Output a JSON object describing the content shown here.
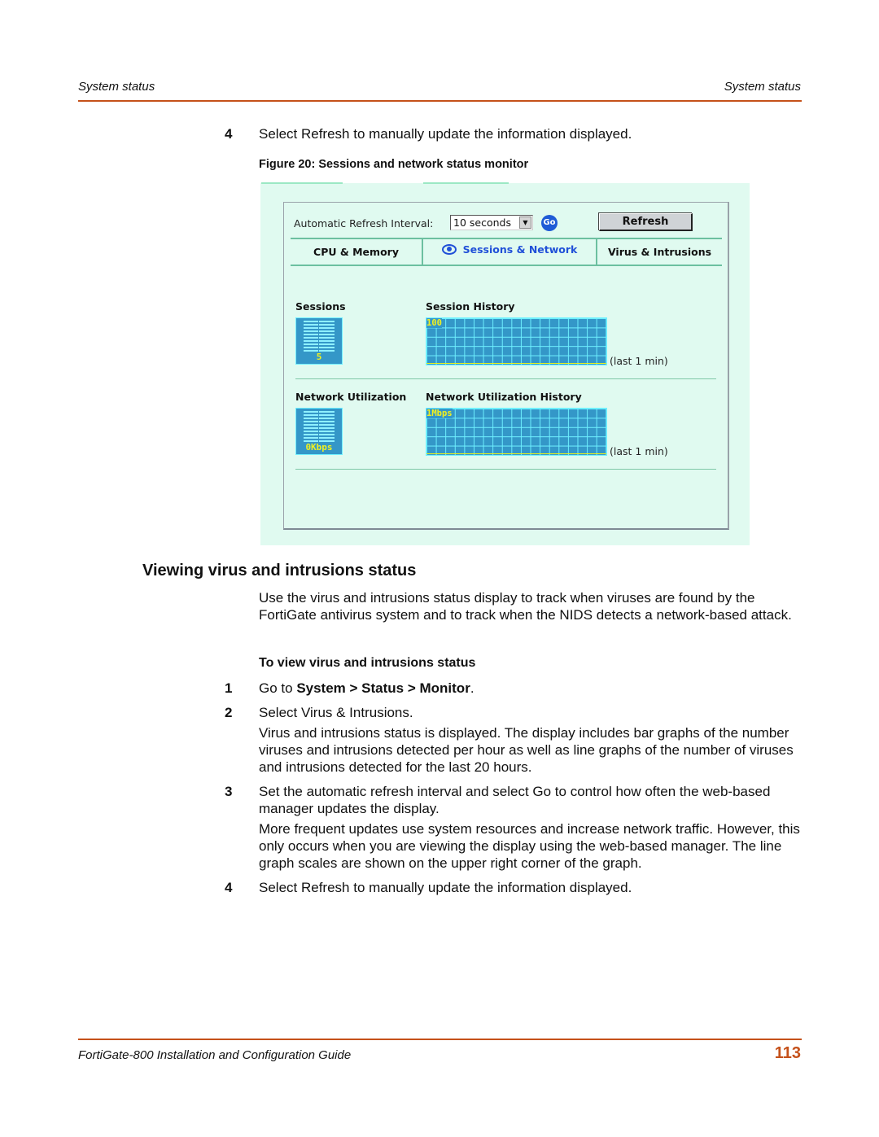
{
  "header": {
    "left": "System status",
    "right": "System status"
  },
  "top_step": {
    "num": "4",
    "text": "Select Refresh to manually update the information displayed."
  },
  "figure": {
    "caption": "Figure 20: Sessions and network status monitor",
    "refresh_interval_label": "Automatic Refresh Interval:",
    "refresh_interval_value": "10 seconds",
    "go_label": "Go",
    "refresh_button": "Refresh",
    "tabs": [
      {
        "label": "CPU & Memory",
        "active": false
      },
      {
        "label": "Sessions & Network",
        "active": true,
        "icon": "eye-icon"
      },
      {
        "label": "Virus & Intrusions",
        "active": false
      }
    ],
    "sessions": {
      "label": "Sessions",
      "current_value": "5",
      "history_label": "Session History",
      "history_scale": "100",
      "history_period": "(last 1 min)"
    },
    "network": {
      "label": "Network Utilization",
      "current_value": "0Kbps",
      "history_label": "Network Utilization History",
      "history_scale": "1Mbps",
      "history_period": "(last 1 min)"
    },
    "colors": {
      "panel_bg": "#e0faf0",
      "graph_bg": "#3497c8",
      "graph_grid": "#6ef0ff",
      "graph_text": "#f0f020",
      "active_tab": "#2050d8"
    }
  },
  "section": {
    "title": "Viewing virus and intrusions status",
    "intro": "Use the virus and intrusions status display to track when viruses are found by the FortiGate antivirus system and to track when the NIDS detects a network-based attack.",
    "procedure_title": "To view virus and intrusions status",
    "steps": [
      {
        "num": "1",
        "pre": "Go to ",
        "bold": "System > Status > Monitor",
        "post": "."
      },
      {
        "num": "2",
        "text": "Select Virus & Intrusions.",
        "sub": "Virus and intrusions status is displayed. The display includes bar graphs of the number viruses and intrusions detected per hour as well as line graphs of the number of viruses and intrusions detected for the last 20 hours."
      },
      {
        "num": "3",
        "text": "Set the automatic refresh interval and select Go to control how often the web-based manager updates the display.",
        "sub": "More frequent updates use system resources and increase network traffic. However, this only occurs when you are viewing the display using the web-based manager. The line graph scales are shown on the upper right corner of the graph."
      },
      {
        "num": "4",
        "text": "Select Refresh to manually update the information displayed."
      }
    ]
  },
  "footer": {
    "guide_title": "FortiGate-800 Installation and Configuration Guide",
    "page_number": "113",
    "accent": "#c5511a"
  }
}
